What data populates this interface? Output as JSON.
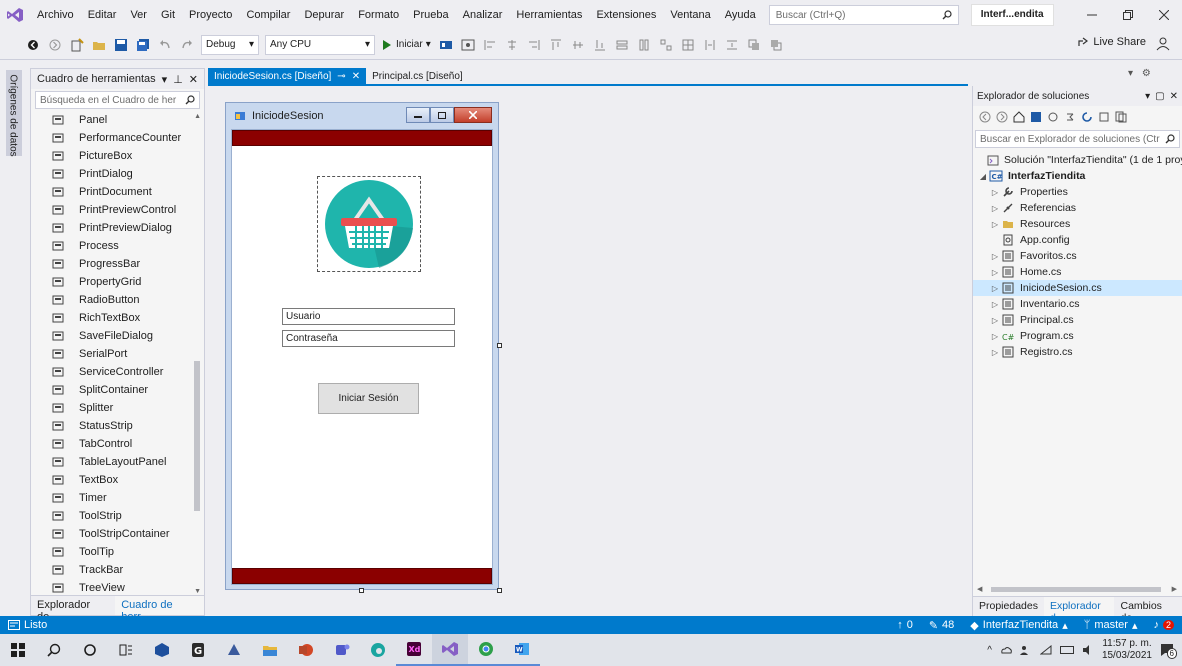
{
  "menu": {
    "items": [
      "Archivo",
      "Editar",
      "Ver",
      "Git",
      "Proyecto",
      "Compilar",
      "Depurar",
      "Formato",
      "Prueba",
      "Analizar",
      "Herramientas",
      "Extensiones",
      "Ventana",
      "Ayuda"
    ],
    "search_placeholder": "Buscar (Ctrl+Q)",
    "project_name": "Interf...endita"
  },
  "toolbar": {
    "config": "Debug",
    "platform": "Any CPU",
    "start_label": "Iniciar",
    "live_share": "Live Share"
  },
  "left_strip": {
    "label": "Orígenes de datos"
  },
  "toolbox": {
    "title": "Cuadro de herramientas",
    "search_placeholder": "Búsqueda en el Cuadro de her",
    "items": [
      "Panel",
      "PerformanceCounter",
      "PictureBox",
      "PrintDialog",
      "PrintDocument",
      "PrintPreviewControl",
      "PrintPreviewDialog",
      "Process",
      "ProgressBar",
      "PropertyGrid",
      "RadioButton",
      "RichTextBox",
      "SaveFileDialog",
      "SerialPort",
      "ServiceController",
      "SplitContainer",
      "Splitter",
      "StatusStrip",
      "TabControl",
      "TableLayoutPanel",
      "TextBox",
      "Timer",
      "ToolStrip",
      "ToolStripContainer",
      "ToolTip",
      "TrackBar",
      "TreeView"
    ],
    "icons": [
      "panel-icon",
      "performance-counter-icon",
      "picturebox-icon",
      "print-dialog-icon",
      "print-document-icon",
      "print-preview-control-icon",
      "print-preview-dialog-icon",
      "process-icon",
      "progressbar-icon",
      "property-grid-icon",
      "radio-button-icon",
      "richtextbox-icon",
      "save-file-dialog-icon",
      "serial-port-icon",
      "service-controller-icon",
      "split-container-icon",
      "splitter-icon",
      "status-strip-icon",
      "tab-control-icon",
      "table-layout-panel-icon",
      "textbox-icon",
      "timer-icon",
      "toolstrip-icon",
      "toolstrip-container-icon",
      "tooltip-icon",
      "trackbar-icon",
      "treeview-icon"
    ],
    "bottom_tabs": [
      "Explorador de...",
      "Cuadro de herr..."
    ]
  },
  "doc_tabs": [
    {
      "label": "IniciodeSesion.cs [Diseño]",
      "active": true
    },
    {
      "label": "Principal.cs [Diseño]",
      "active": false
    }
  ],
  "form": {
    "title": "IniciodeSesion",
    "username_text": "Usuario",
    "password_text": "Contraseña",
    "login_button": "Iniciar Sesión",
    "bar_color": "#8b0000",
    "logo_color": "#1fb5ac"
  },
  "solution_explorer": {
    "title": "Explorador de soluciones",
    "search_placeholder": "Buscar en Explorador de soluciones (Ctr",
    "solution": "Solución \"InterfazTiendita\" (1 de 1 proye",
    "project": "InterfazTiendita",
    "items": [
      {
        "label": "Properties",
        "icon": "wrench-icon",
        "expandable": true,
        "selected": false
      },
      {
        "label": "Referencias",
        "icon": "references-icon",
        "expandable": true,
        "selected": false
      },
      {
        "label": "Resources",
        "icon": "folder-icon",
        "expandable": true,
        "selected": false
      },
      {
        "label": "App.config",
        "icon": "config-file-icon",
        "expandable": false,
        "selected": false
      },
      {
        "label": "Favoritos.cs",
        "icon": "form-file-icon",
        "expandable": true,
        "selected": false
      },
      {
        "label": "Home.cs",
        "icon": "form-file-icon",
        "expandable": true,
        "selected": false
      },
      {
        "label": "IniciodeSesion.cs",
        "icon": "form-file-icon",
        "expandable": true,
        "selected": true
      },
      {
        "label": "Inventario.cs",
        "icon": "form-file-icon",
        "expandable": true,
        "selected": false
      },
      {
        "label": "Principal.cs",
        "icon": "form-file-icon",
        "expandable": true,
        "selected": false
      },
      {
        "label": "Program.cs",
        "icon": "csharp-file-icon",
        "expandable": true,
        "selected": false
      },
      {
        "label": "Registro.cs",
        "icon": "form-file-icon",
        "expandable": true,
        "selected": false
      }
    ],
    "bottom_tabs": [
      "Propiedades",
      "Explorador d...",
      "Cambios de..."
    ]
  },
  "status": {
    "ready": "Listo",
    "up_count": "0",
    "edits_count": "48",
    "repo": "InterfazTiendita",
    "branch": "master",
    "notifications": "2",
    "accent": "#007acc"
  },
  "taskbar": {
    "time": "11:57 p. m.",
    "date": "15/03/2021",
    "notif_count": "6"
  }
}
